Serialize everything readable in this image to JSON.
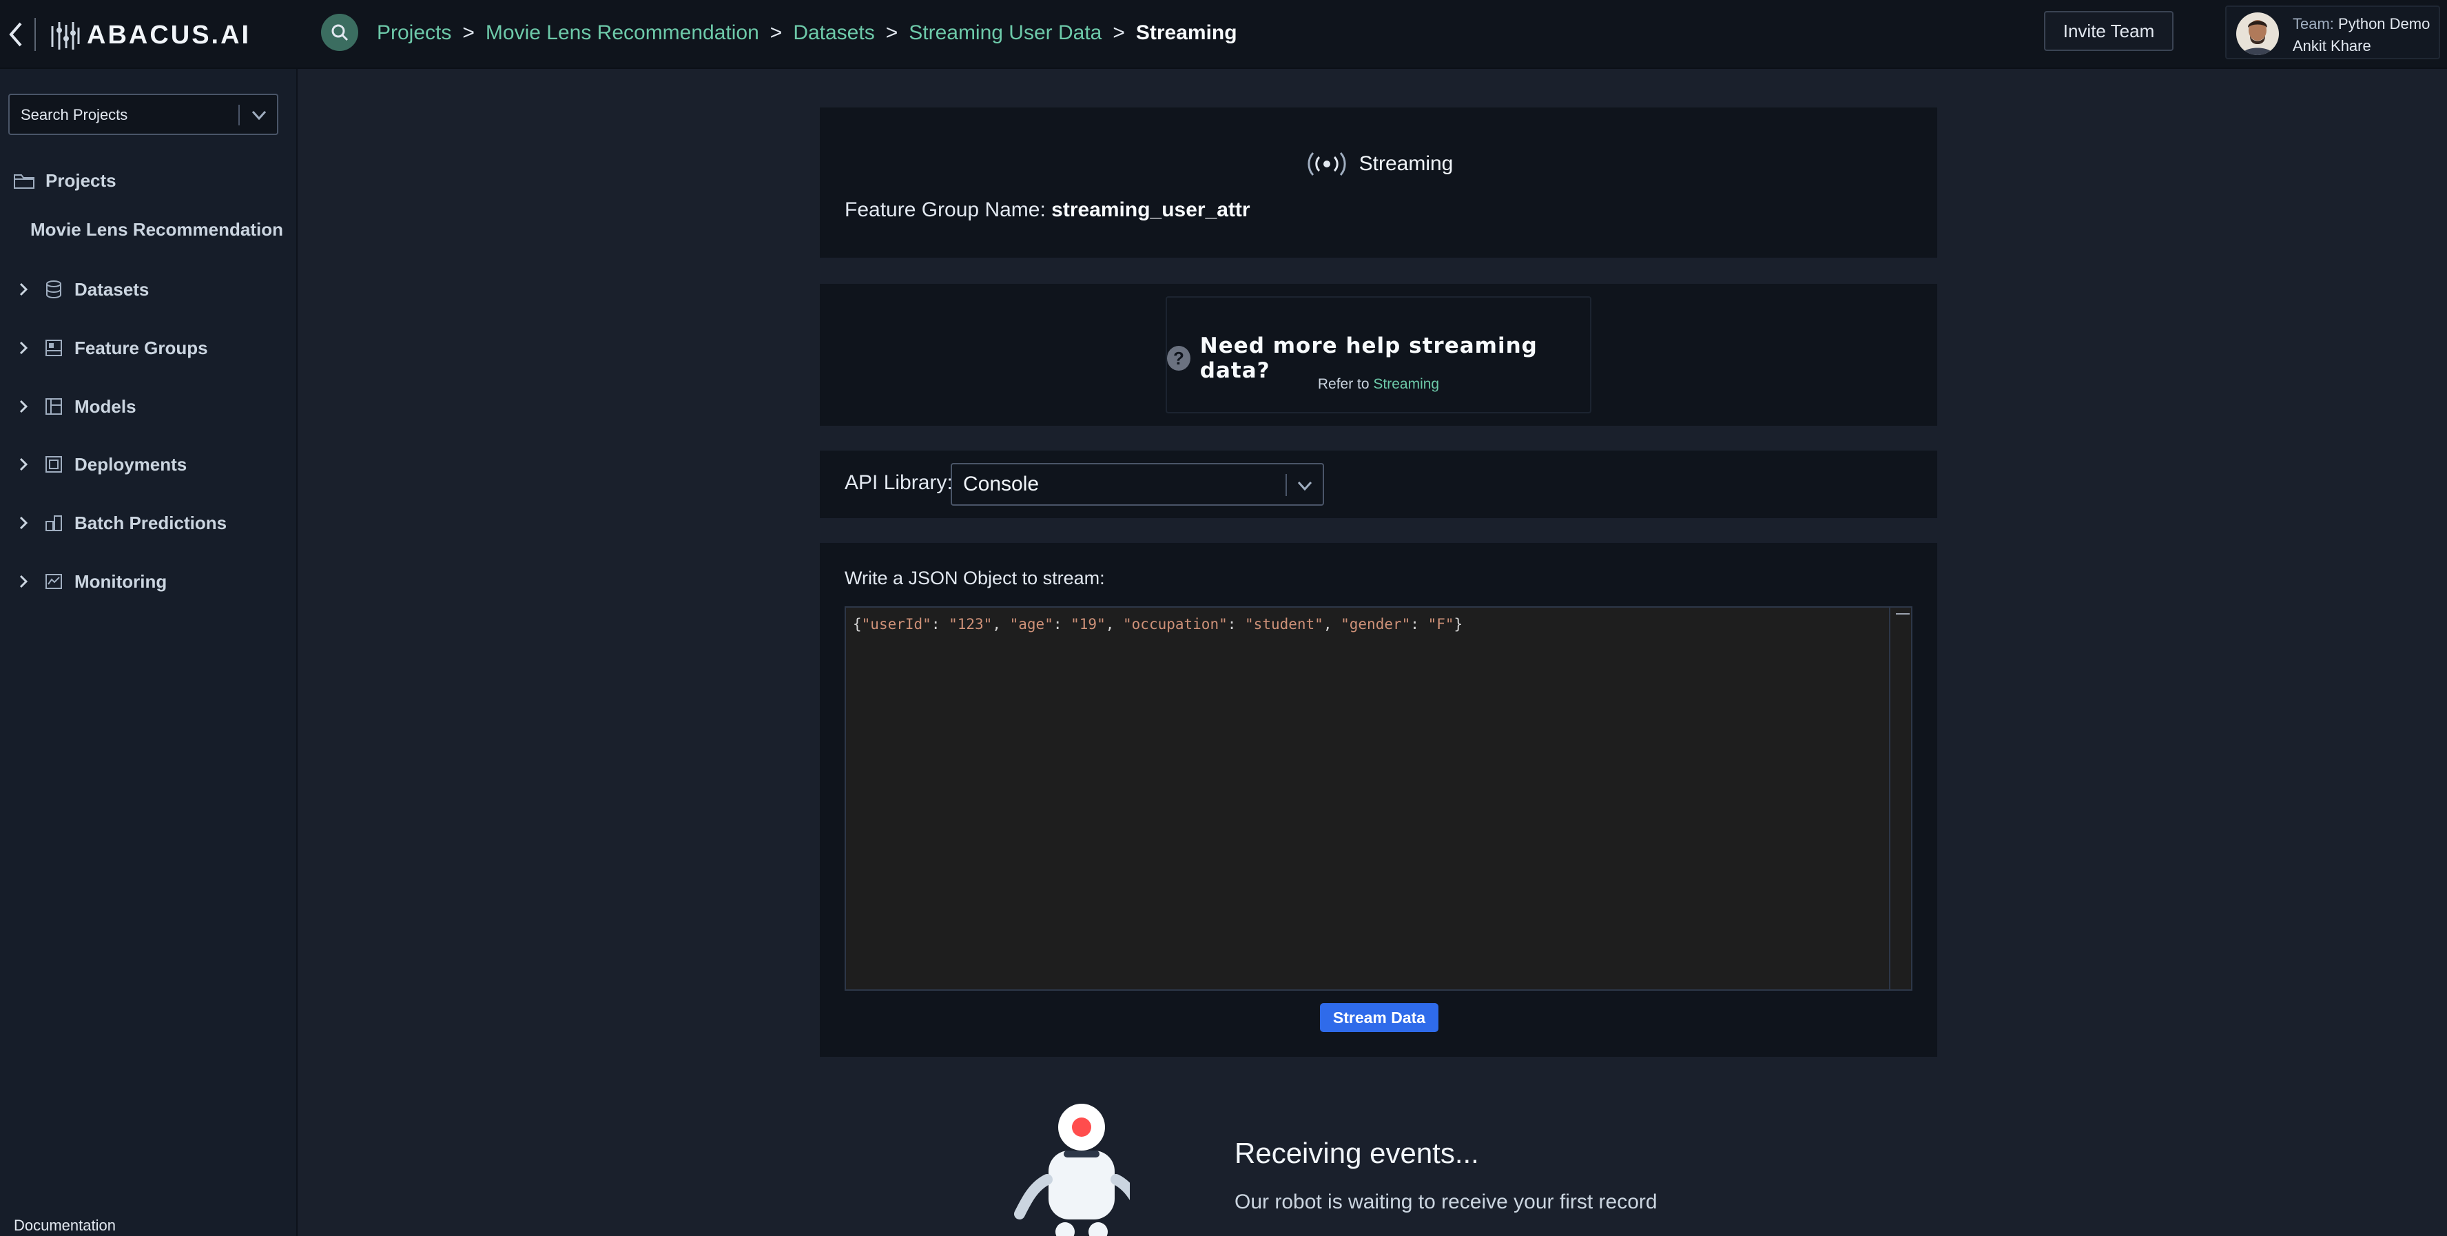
{
  "brand": {
    "logo_text": "ABACUS.AI"
  },
  "sidebar": {
    "search_placeholder": "Search Projects",
    "projects_label": "Projects",
    "project_name": "Movie Lens Recommendation",
    "items": [
      {
        "label": "Datasets",
        "icon": "database-icon"
      },
      {
        "label": "Feature Groups",
        "icon": "feature-groups-icon"
      },
      {
        "label": "Models",
        "icon": "models-icon"
      },
      {
        "label": "Deployments",
        "icon": "deployments-icon"
      },
      {
        "label": "Batch Predictions",
        "icon": "batch-predictions-icon"
      },
      {
        "label": "Monitoring",
        "icon": "monitoring-icon"
      }
    ],
    "documentation": "Documentation"
  },
  "header": {
    "breadcrumbs": [
      "Projects",
      "Movie Lens Recommendation",
      "Datasets",
      "Streaming User Data"
    ],
    "separator": ">",
    "current": "Streaming",
    "invite_label": "Invite Team",
    "team_label": "Team:",
    "team_name": "Python Demo",
    "user_name": "Ankit Khare"
  },
  "streaming": {
    "title": "Streaming",
    "fg_label": "Feature Group Name:",
    "fg_name": "streaming_user_attr"
  },
  "help": {
    "icon_char": "?",
    "title": "Need more help streaming data?",
    "refer_prefix": "Refer to",
    "refer_link": "Streaming"
  },
  "api": {
    "label": "API Library:",
    "selected": "Console"
  },
  "json_editor": {
    "label": "Write a JSON Object to stream:",
    "content": "{\"userId\": \"123\", \"age\": \"19\", \"occupation\": \"student\", \"gender\": \"F\"}",
    "button": "Stream Data"
  },
  "receiving": {
    "title": "Receiving events...",
    "subtitle": "Our robot is waiting to receive your first record"
  },
  "colors": {
    "accent": "#6dc9a9",
    "primary_button": "#2f6bea",
    "background": "#1a202c",
    "panel": "#0f141c"
  }
}
